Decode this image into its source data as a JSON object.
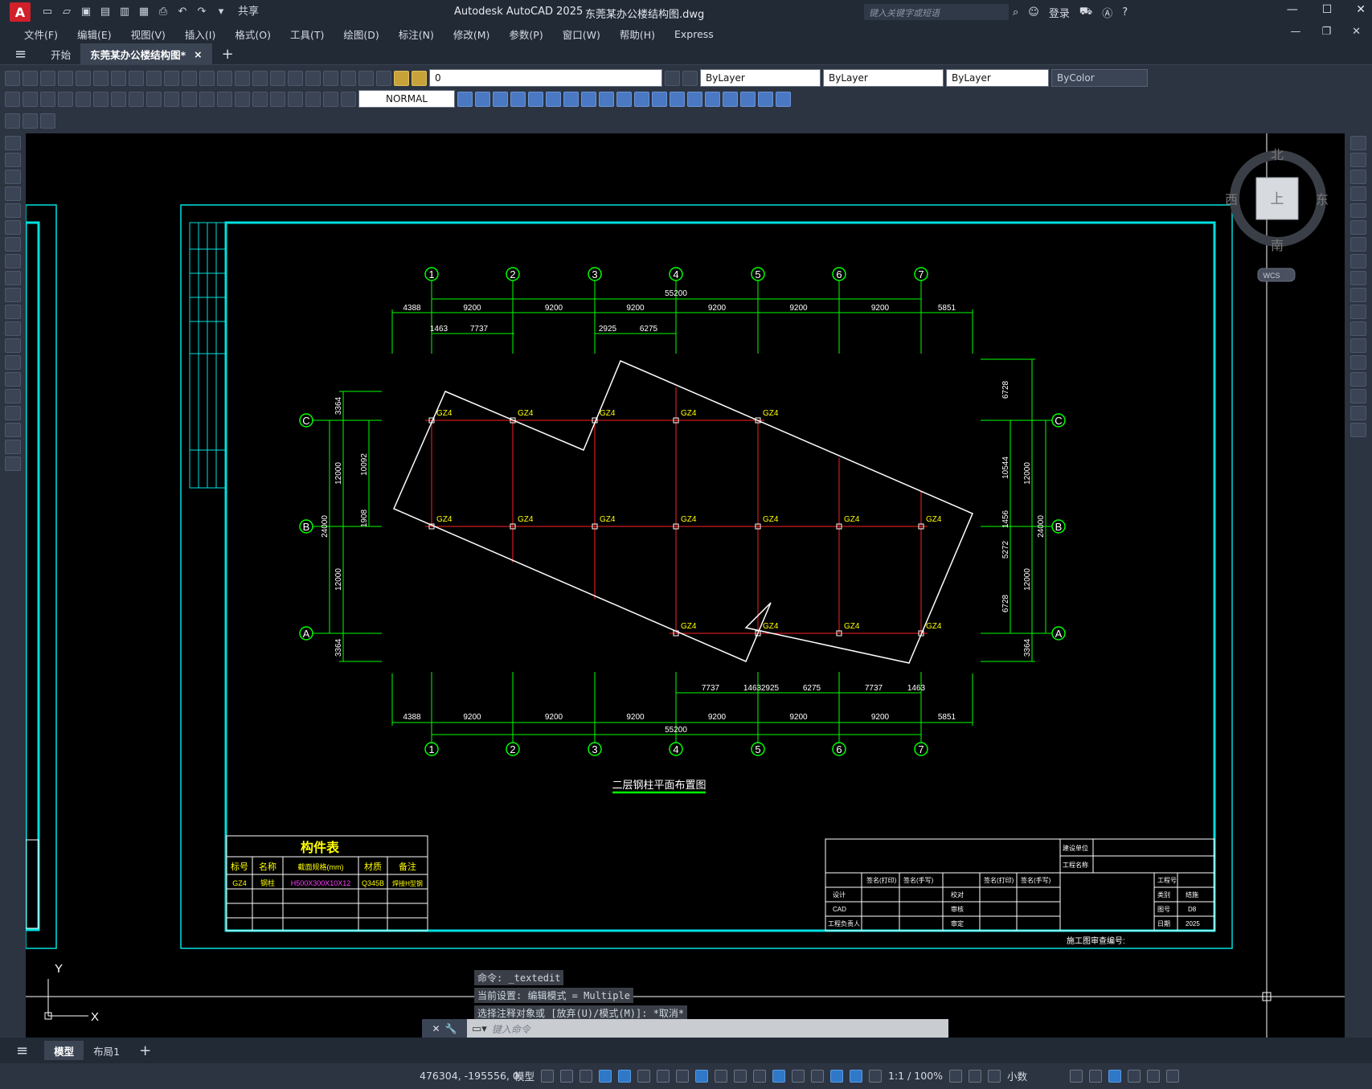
{
  "window": {
    "app_logo": "A",
    "title": "Autodesk AutoCAD 2025",
    "document": "东莞某办公楼结构图.dwg",
    "search_placeholder": "键入关键字或短语",
    "login": "登录",
    "share": "共享"
  },
  "menu": [
    "文件(F)",
    "编辑(E)",
    "视图(V)",
    "插入(I)",
    "格式(O)",
    "工具(T)",
    "绘图(D)",
    "标注(N)",
    "修改(M)",
    "参数(P)",
    "窗口(W)",
    "帮助(H)",
    "Express"
  ],
  "tabs": {
    "start": "开始",
    "doc": "东莞某办公楼结构图*"
  },
  "toolbar": {
    "layer_value": "0",
    "color_combo": "ByLayer",
    "linetype_combo": "ByLayer",
    "lineweight_combo": "ByLayer",
    "plotstyle_combo": "ByColor",
    "dimstyle_combo": "NORMAL"
  },
  "viewcube": {
    "north": "北",
    "south": "南",
    "east": "东",
    "west": "西",
    "top": "上",
    "wcs": "WCS"
  },
  "drawing": {
    "title": "二层钢柱平面布置图",
    "col_axes": [
      "1",
      "2",
      "3",
      "4",
      "5",
      "6",
      "7"
    ],
    "row_axes": [
      "C",
      "B",
      "A"
    ],
    "top_dims": [
      "4388",
      "9200",
      "9200",
      "9200",
      "9200",
      "9200",
      "9200",
      "5851"
    ],
    "total": "55200",
    "top_sub": [
      "1463",
      "7737",
      "2925",
      "6275"
    ],
    "bottom_sub": [
      "7737",
      "1463",
      "2925",
      "6275",
      "7737",
      "1463"
    ],
    "left_dims": [
      "3364",
      "12000",
      "12000",
      "3364"
    ],
    "left_total": "24000",
    "left_inner": [
      "10092",
      "1908"
    ],
    "right_dims": [
      "6728",
      "10544",
      "1456",
      "5272",
      "6728"
    ],
    "right_mid": [
      "12000",
      "12000",
      "3364"
    ],
    "right_total": "24000",
    "column_label": "GZ4",
    "member_table": {
      "title": "构件表",
      "headers": [
        "标号",
        "名称",
        "截面规格(mm)",
        "材质",
        "备注"
      ],
      "row": [
        "GZ4",
        "钢柱",
        "H500X300X10X12",
        "Q345B",
        "焊接H型钢"
      ]
    },
    "titleblock": {
      "construction_unit": "建设单位",
      "project_name": "工程名称",
      "sign_name": "签名(打印)",
      "sign_hand": "签名(手写)",
      "design": "设计",
      "cad": "CAD",
      "proj_lead": "工程负责人",
      "check": "校对",
      "review": "审核",
      "approve": "审定",
      "drawing_no": "工程号",
      "category": "类别",
      "category_val": "结施",
      "drawing_num": "图号",
      "drawing_num_val": "D8",
      "date": "日期",
      "date_val": "2025",
      "review_no": "施工图审查编号:"
    }
  },
  "command": {
    "lines": [
      "命令: _textedit",
      "当前设置: 编辑模式 = Multiple",
      "选择注释对象或 [放弃(U)/模式(M)]: *取消*"
    ],
    "placeholder": "键入命令"
  },
  "layout_tabs": {
    "model": "模型",
    "layout1": "布局1"
  },
  "status": {
    "coords": "476304, -195556, 0",
    "model": "模型",
    "scale": "1:1 / 100%",
    "units": "小数"
  },
  "colors": {
    "grid": "#00ff00",
    "axis_line": "#ff2020",
    "outline": "#ffffff",
    "frame": "#00e0e0",
    "label": "#ffff00"
  }
}
